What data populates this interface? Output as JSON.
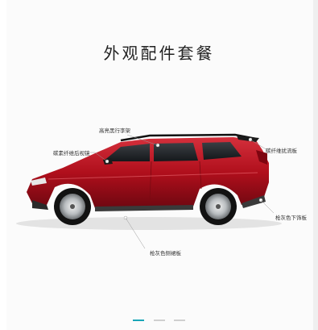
{
  "page": {
    "title": "外观配件套餐"
  },
  "labels": {
    "roof_rack": "高亮黑行李架",
    "mirror": "碳素纤维后视镜",
    "spoiler": "碳纤维扰流板",
    "rear_lower_trim": "枪灰色下饰板",
    "side_skirt": "枪灰色侧裙板"
  },
  "colors": {
    "accent": "#1aa6b7",
    "car_body": "#b00f1c",
    "inactive_dot": "#cfcfcf"
  },
  "carousel": {
    "slides_total": 3,
    "active_index": 1
  }
}
